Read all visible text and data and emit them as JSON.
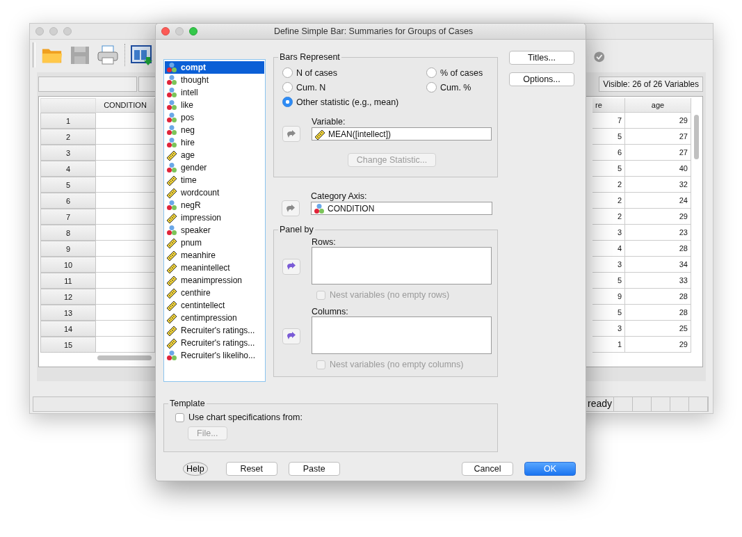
{
  "background_window": {
    "visible_label": "Visible: 26 of 26 Variables",
    "columns": [
      "CONDITION",
      "re",
      "age"
    ],
    "rows": [
      {
        "number": "1",
        "column_2": "7",
        "age": "29"
      },
      {
        "number": "2",
        "column_2": "5",
        "age": "27"
      },
      {
        "number": "3",
        "column_2": "6",
        "age": "27"
      },
      {
        "number": "4",
        "column_2": "5",
        "age": "40"
      },
      {
        "number": "5",
        "column_2": "2",
        "age": "32"
      },
      {
        "number": "6",
        "column_2": "2",
        "age": "24"
      },
      {
        "number": "7",
        "column_2": "2",
        "age": "29"
      },
      {
        "number": "8",
        "column_2": "3",
        "age": "23"
      },
      {
        "number": "9",
        "column_2": "4",
        "age": "28"
      },
      {
        "number": "10",
        "column_2": "3",
        "age": "34"
      },
      {
        "number": "11",
        "column_2": "5",
        "age": "33"
      },
      {
        "number": "12",
        "column_2": "9",
        "age": "28"
      },
      {
        "number": "13",
        "column_2": "5",
        "age": "28"
      },
      {
        "number": "14",
        "column_2": "3",
        "age": "25"
      },
      {
        "number": "15",
        "column_2": "1",
        "age": "29"
      }
    ],
    "status_bar": "ready"
  },
  "dialog": {
    "title": "Define Simple Bar: Summaries for Groups of Cases",
    "variables": [
      {
        "name": "compt",
        "kind": "nominal",
        "selected": true
      },
      {
        "name": "thought",
        "kind": "nominal",
        "selected": false
      },
      {
        "name": "intell",
        "kind": "nominal",
        "selected": false
      },
      {
        "name": "like",
        "kind": "nominal",
        "selected": false
      },
      {
        "name": "pos",
        "kind": "nominal",
        "selected": false
      },
      {
        "name": "neg",
        "kind": "nominal",
        "selected": false
      },
      {
        "name": "hire",
        "kind": "nominal",
        "selected": false
      },
      {
        "name": "age",
        "kind": "scale",
        "selected": false
      },
      {
        "name": "gender",
        "kind": "nominal",
        "selected": false
      },
      {
        "name": "time",
        "kind": "scale",
        "selected": false
      },
      {
        "name": "wordcount",
        "kind": "scale",
        "selected": false
      },
      {
        "name": "negR",
        "kind": "nominal",
        "selected": false
      },
      {
        "name": "impression",
        "kind": "scale",
        "selected": false
      },
      {
        "name": "speaker",
        "kind": "nominal",
        "selected": false
      },
      {
        "name": "pnum",
        "kind": "scale",
        "selected": false
      },
      {
        "name": "meanhire",
        "kind": "scale",
        "selected": false
      },
      {
        "name": "meanintellect",
        "kind": "scale",
        "selected": false
      },
      {
        "name": "meanimpression",
        "kind": "scale",
        "selected": false
      },
      {
        "name": "centhire",
        "kind": "scale",
        "selected": false
      },
      {
        "name": "centintellect",
        "kind": "scale",
        "selected": false
      },
      {
        "name": "centimpression",
        "kind": "scale",
        "selected": false
      },
      {
        "name": "Recruiter's ratings...",
        "kind": "scale",
        "selected": false
      },
      {
        "name": "Recruiter's ratings...",
        "kind": "scale",
        "selected": false
      },
      {
        "name": "Recruiter's likeliho...",
        "kind": "nominal",
        "selected": false
      }
    ],
    "bars_represent": {
      "title": "Bars Represent",
      "options": [
        {
          "label": "N of cases",
          "selected": false
        },
        {
          "label": "% of cases",
          "selected": false
        },
        {
          "label": "Cum. N",
          "selected": false
        },
        {
          "label": "Cum. %",
          "selected": false
        },
        {
          "label": "Other statistic (e.g., mean)",
          "selected": true
        }
      ]
    },
    "variable": {
      "label": "Variable:",
      "value": "MEAN([intellect])",
      "kind": "scale",
      "arrow_disabled": true
    },
    "change_statistic": {
      "label": "Change Statistic...",
      "disabled": true
    },
    "category_axis": {
      "label": "Category Axis:",
      "value": "CONDITION",
      "kind": "nominal",
      "arrow_disabled": true
    },
    "panel_by": {
      "title": "Panel by",
      "sections": [
        {
          "label": "Rows:",
          "arrow_disabled": false,
          "nest": {
            "label": "Nest variables (no empty rows)",
            "checked": false,
            "disabled": true
          }
        },
        {
          "label": "Columns:",
          "arrow_disabled": false,
          "nest": {
            "label": "Nest variables (no empty columns)",
            "checked": false,
            "disabled": true
          }
        }
      ]
    },
    "side_buttons": [
      "Titles...",
      "Options..."
    ],
    "template": {
      "title": "Template",
      "checkbox": {
        "label": "Use chart specifications from:",
        "checked": false
      },
      "file_button": {
        "label": "File...",
        "disabled": true
      }
    },
    "bottom_buttons": [
      {
        "label": "Help",
        "kind": "help"
      },
      {
        "label": "Reset",
        "kind": "normal"
      },
      {
        "label": "Paste",
        "kind": "normal"
      },
      {
        "label": "Cancel",
        "kind": "normal"
      },
      {
        "label": "OK",
        "kind": "default"
      }
    ]
  }
}
